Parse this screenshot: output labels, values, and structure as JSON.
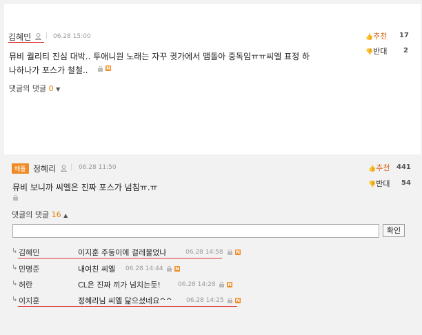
{
  "comment1": {
    "author": "김혜민",
    "date": "06.28 15:00",
    "text_line1": "뮤비 퀄리티 진심 대박.. 투애니원 노래는 자꾸 귓가에서 맴돌아 중독임ㅠㅠ씨엘 표정 하",
    "text_line2": "나하나가 포스가 철철..",
    "recommend_label": "추천",
    "recommend_count": "17",
    "oppose_label": "반대",
    "oppose_count": "2",
    "replies_label": "댓글의 댓글",
    "replies_count": "0",
    "new_mark": "N"
  },
  "comment2": {
    "badge": "베플",
    "author": "정혜리",
    "date": "06.28 11:50",
    "text": "뮤비 보니까 씨엘은 진짜 포스가 넘침ㅠ.ㅠ",
    "recommend_label": "추천",
    "recommend_count": "441",
    "oppose_label": "반대",
    "oppose_count": "54",
    "replies_label": "댓글의 댓글",
    "replies_count": "16",
    "reply_input_placeholder": "",
    "confirm_button": "확인",
    "replies": [
      {
        "name": "김혜민",
        "text": "이지훈 주둥이에 걸레물었나",
        "date": "06.28 14:58",
        "new": "N"
      },
      {
        "name": "민명준",
        "text": "내여친 씨엘",
        "date": "06.28 14:44",
        "new": "N"
      },
      {
        "name": "허란",
        "text": "CL은 진짜 끼가 넘치는듯!",
        "date": "06.28 14:28",
        "new": "N"
      },
      {
        "name": "이지훈",
        "text": "정혜리님 씨엘 닮으셨네요^^",
        "date": "06.28 14:25",
        "new": "N"
      }
    ]
  },
  "colors": {
    "accent": "#f08a24",
    "underline_red": "#e03030",
    "panel_bg": "#f2f2f2"
  },
  "icons": [
    "user-icon",
    "thumbs-up-icon",
    "thumbs-down-icon",
    "lock-icon",
    "reply-arrow-icon",
    "triangle-down-icon",
    "triangle-up-icon"
  ]
}
